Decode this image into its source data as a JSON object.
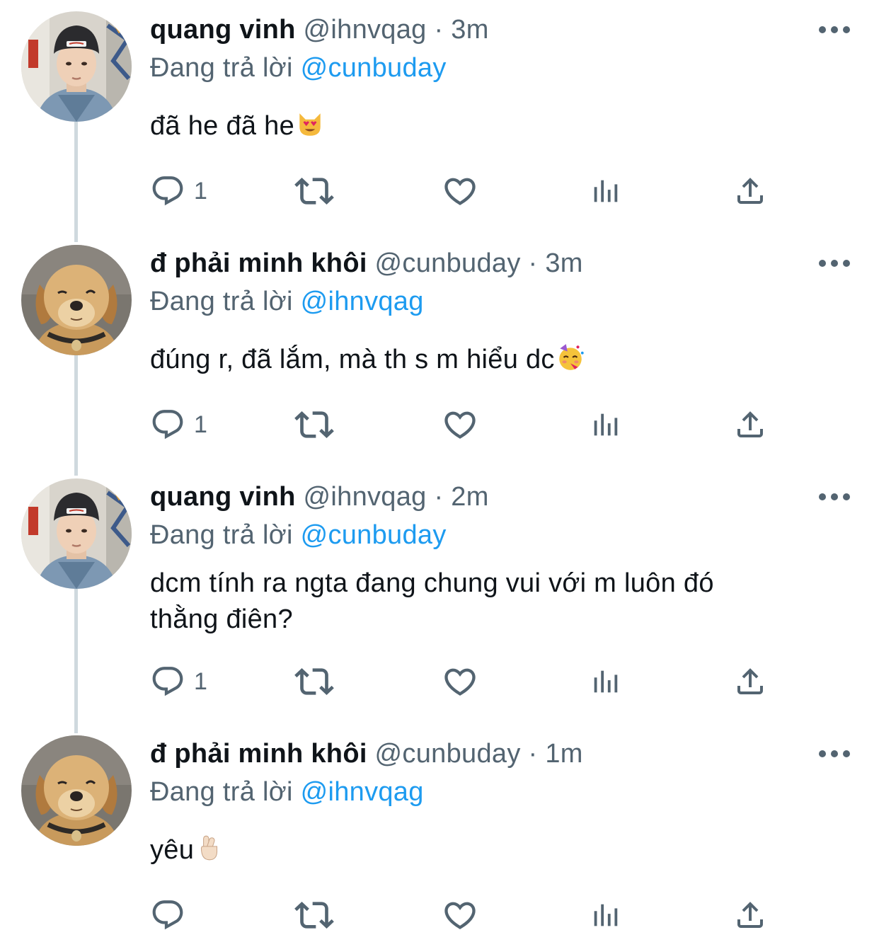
{
  "reply_prefix": "Đang trả lời",
  "icons": {
    "reply": "reply-icon",
    "retweet": "retweet-icon",
    "like": "like-icon",
    "analytics": "analytics-icon",
    "share": "share-icon",
    "more": "more-options-icon"
  },
  "colors": {
    "text": "#0f1419",
    "secondary": "#536471",
    "link": "#1d9bf0",
    "connector": "#cfd9de"
  },
  "tweets": [
    {
      "display_name": "quang vinh",
      "handle": "@ihnvqag",
      "separator": "·",
      "time": "3m",
      "replying_to": "@cunbuday",
      "text": "đã he đã he",
      "emoji": "heart-eyes-cat",
      "reply_count": "1",
      "avatar": "person-avatar"
    },
    {
      "display_name": "đ phải minh khôi",
      "handle": "@cunbuday",
      "separator": "·",
      "time": "3m",
      "replying_to": "@ihnvqag",
      "text": "đúng r, đã lắm, mà th s m hiểu dc",
      "emoji": "partying-face",
      "reply_count": "1",
      "avatar": "dog-avatar"
    },
    {
      "display_name": "quang vinh",
      "handle": "@ihnvqag",
      "separator": "·",
      "time": "2m",
      "replying_to": "@cunbuday",
      "text_line1": "dcm tính ra ngta đang chung vui với m luôn đó",
      "text_line2": "thằng điên?",
      "reply_count": "1",
      "avatar": "person-avatar"
    },
    {
      "display_name": "đ phải minh khôi",
      "handle": "@cunbuday",
      "separator": "·",
      "time": "1m",
      "replying_to": "@ihnvqag",
      "text": "yêu",
      "emoji": "crossed-fingers",
      "reply_count": "",
      "avatar": "dog-avatar"
    }
  ]
}
